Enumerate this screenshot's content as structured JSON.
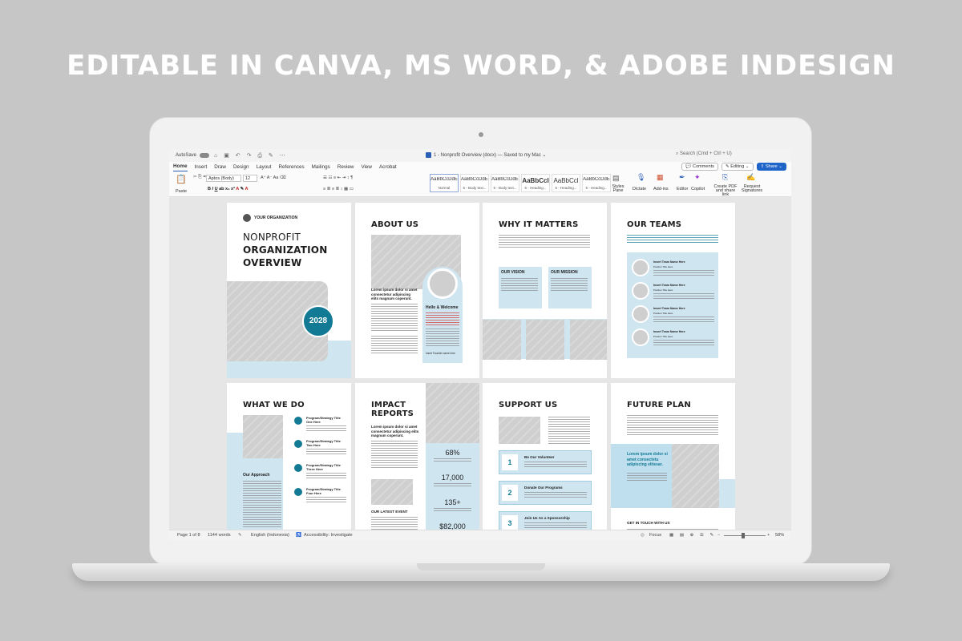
{
  "headline": "EDITABLE IN CANVA, MS WORD, & ADOBE INDESIGN",
  "app": {
    "autosave_label": "AutoSave",
    "doc_title": "1 - Nonprofit Overview (docx) — Saved to my Mac",
    "search_placeholder": "Search (Cmd + Ctrl + U)",
    "menu": [
      "Home",
      "Insert",
      "Draw",
      "Design",
      "Layout",
      "References",
      "Mailings",
      "Review",
      "View",
      "Acrobat"
    ],
    "comments_label": "Comments",
    "editing_label": "Editing",
    "share_label": "Share",
    "paste_label": "Paste",
    "font_name": "Aptos (Body)",
    "font_size": "12",
    "styles": [
      {
        "sample": "AaBbCcDdE",
        "name": "Normal"
      },
      {
        "sample": "AaBbCcDdEe",
        "name": "5 - Body text..."
      },
      {
        "sample": "AaBbCcDdEe",
        "name": "5 - Body text..."
      },
      {
        "sample": "AaBbCcI",
        "name": "5 - Heading..."
      },
      {
        "sample": "AaBbCcl",
        "name": "5 - Heading..."
      },
      {
        "sample": "AaBbCcDdE",
        "name": "5 - Heading..."
      }
    ],
    "ribbon_tools": {
      "styles_pane": "Styles Pane",
      "dictate": "Dictate",
      "addins": "Add-ins",
      "editor": "Editor",
      "copilot": "Copilot",
      "create_pdf": "Create PDF and share link",
      "request_sig": "Request Signatures"
    },
    "status": {
      "page": "Page 1 of 8",
      "words": "1144 words",
      "language": "English (Indonesia)",
      "accessibility": "Accessibility: Investigate",
      "focus": "Focus",
      "zoom": "58%"
    }
  },
  "pages": {
    "p1": {
      "org": "YOUR ORGANIZATION",
      "title1": "NONPROFIT",
      "title2": "ORGANIZATION",
      "title3": "OVERVIEW",
      "year": "2028"
    },
    "p2": {
      "title": "ABOUT US",
      "lead": "Lorem ipsum dolor si amet consectetur adipiscing elits magnum coperunt.",
      "hello": "Hello & Welcome",
      "sign": "Insert Founder name here"
    },
    "p3": {
      "title": "WHY IT MATTERS",
      "vision": "OUR VISION",
      "mission": "OUR MISSION"
    },
    "p4": {
      "title": "OUR TEAMS",
      "member": "Insert Team Name Here",
      "position": "Position Title Here"
    },
    "p5": {
      "title": "WHAT WE DO",
      "items": [
        "Program/Strategy Title One Here",
        "Program/Strategy Title Two Here",
        "Program/Strategy Title Three Here",
        "Program/Strategy Title Four Here"
      ],
      "approach": "Our Approach"
    },
    "p6": {
      "title1": "IMPACT",
      "title2": "REPORTS",
      "lead": "Lorem ipsum dolor si amet consectetur adipiscing elits magnum coperunt.",
      "stats": [
        "68%",
        "17,000",
        "135+",
        "$82,000"
      ],
      "event": "OUR LATEST EVENT"
    },
    "p7": {
      "title": "SUPPORT US",
      "items": [
        {
          "n": "1",
          "label": "Be Our Volunteer"
        },
        {
          "n": "2",
          "label": "Donate Our Programs"
        },
        {
          "n": "3",
          "label": "Join Us As a Sponsorship"
        }
      ]
    },
    "p8": {
      "title": "FUTURE PLAN",
      "lead": "Lorem ipsum dolor si amet consectetu adipiscing elitesar.",
      "touch": "GET IN TOUCH WITH US"
    }
  },
  "colors": {
    "teal": "#127a94",
    "light_blue": "#cfe5f0",
    "word_blue": "#2b5fb6"
  }
}
